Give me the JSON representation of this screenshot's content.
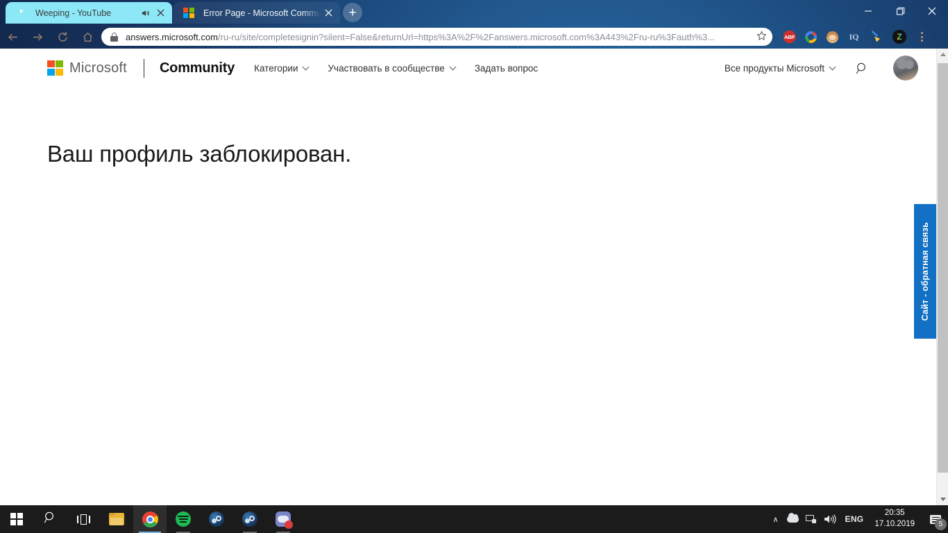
{
  "browser": {
    "tabs": [
      {
        "title": "Weeping - YouTube",
        "favicon": "youtube-icon",
        "active": true,
        "muted_icon": "speaker-icon",
        "close_label": "×"
      },
      {
        "title": "Error Page - Microsoft Communit",
        "favicon": "microsoft-icon",
        "active": false,
        "close_label": "×"
      }
    ],
    "new_tab_label": "+",
    "window_controls": {
      "minimize": "—",
      "maximize": "❐",
      "close": "✕"
    },
    "toolbar": {
      "back_icon": "←",
      "forward_icon": "→",
      "reload_icon": "⟳",
      "home_icon": "⌂",
      "url_secure_part": "answers.microsoft.com",
      "url_rest": "/ru-ru/site/completesignin?silent=False&returnUrl=https%3A%2F%2Fanswers.microsoft.com%3A443%2Fru-ru%3Fauth%3...",
      "star_icon": "☆",
      "extensions": [
        {
          "name": "adblock-plus-icon",
          "label": "ABP"
        },
        {
          "name": "google-icon",
          "label": ""
        },
        {
          "name": "monkey-extension-icon",
          "label": ""
        },
        {
          "name": "iq-extension-icon",
          "label": "IQ"
        },
        {
          "name": "cleaner-broom-icon",
          "label": ""
        }
      ],
      "profile_letter": "Z",
      "menu_icon": "kebab-menu-icon"
    }
  },
  "site_header": {
    "logo_name": "microsoft-logo",
    "wordmark": "Microsoft",
    "brand": "Community",
    "nav_items": [
      {
        "label": "Категории",
        "has_chevron": true
      },
      {
        "label": "Участвовать в сообществе",
        "has_chevron": true
      },
      {
        "label": "Задать вопрос",
        "has_chevron": false
      }
    ],
    "all_products": "Все продукты Microsoft",
    "search_icon": "search-icon",
    "avatar_name": "user-avatar-cat"
  },
  "page": {
    "heading": "Ваш профиль заблокирован.",
    "feedback_tab": "Сайт - обратная связь",
    "accent_color": "#1271c4",
    "background": "#ffffff"
  },
  "taskbar": {
    "items": [
      {
        "name": "start-button",
        "label": ""
      },
      {
        "name": "search-button",
        "label": "⌕"
      },
      {
        "name": "task-view-button",
        "label": ""
      },
      {
        "name": "file-explorer-button",
        "label": ""
      },
      {
        "name": "chrome-button",
        "label": ""
      },
      {
        "name": "spotify-button",
        "label": ""
      },
      {
        "name": "steam-button",
        "label": ""
      },
      {
        "name": "steam-2-button",
        "label": ""
      },
      {
        "name": "discord-button",
        "label": ""
      }
    ],
    "tray": {
      "chevron": "∧",
      "onedrive": "onedrive-cloud-icon",
      "network": "network-icon",
      "volume": "🔊",
      "language": "ENG",
      "time": "20:35",
      "date": "17.10.2019",
      "notification_count": "5"
    }
  }
}
